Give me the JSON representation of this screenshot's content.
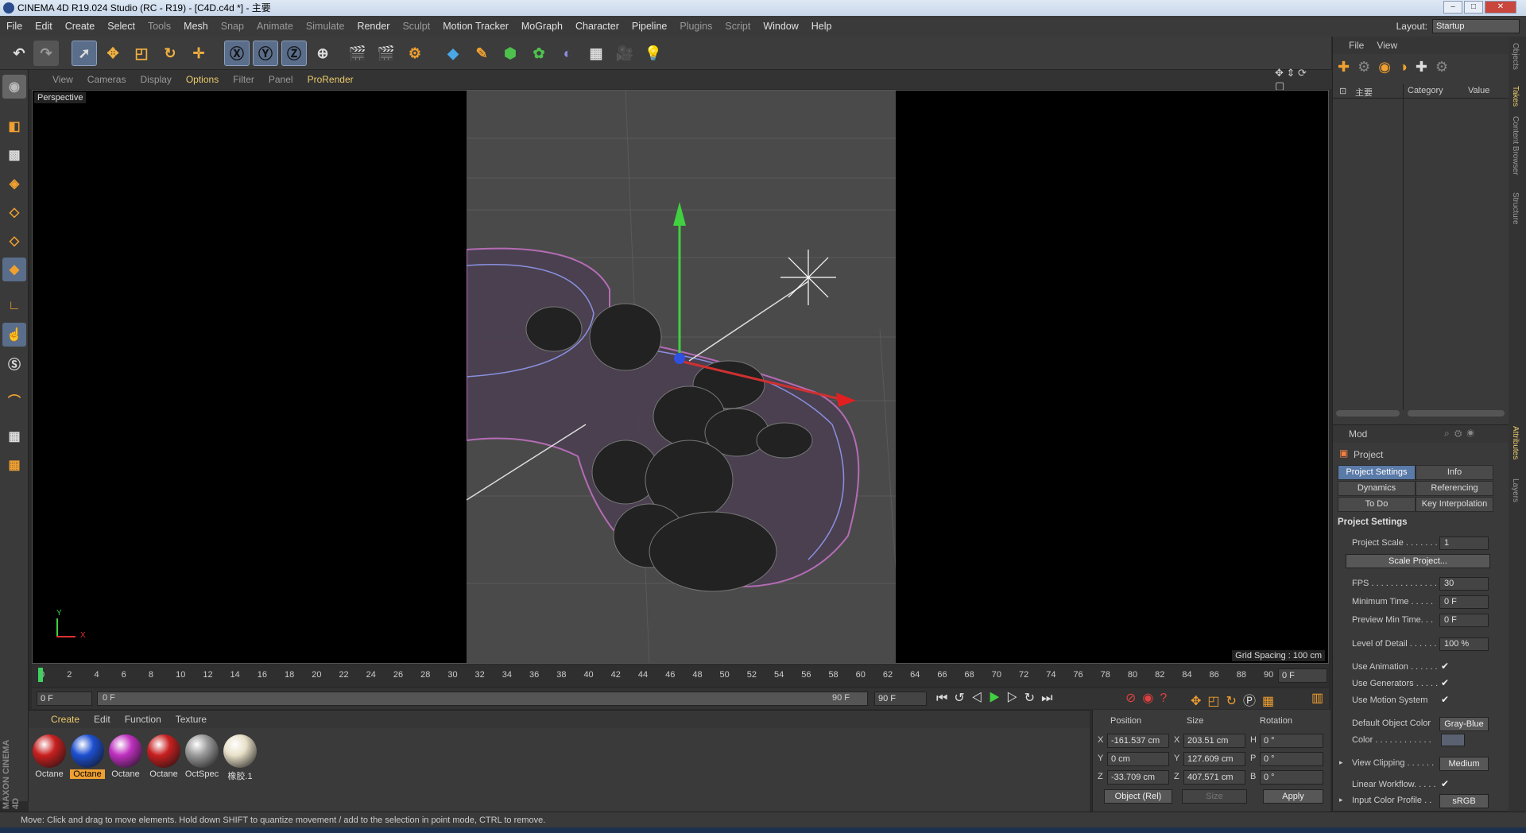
{
  "window": {
    "title": "CINEMA 4D R19.024 Studio (RC - R19) - [C4D.c4d *] - 主要"
  },
  "menu": [
    "File",
    "Edit",
    "Create",
    "Select",
    "Tools",
    "Mesh",
    "Snap",
    "Animate",
    "Simulate",
    "Render",
    "Sculpt",
    "Motion Tracker",
    "MoGraph",
    "Character",
    "Pipeline",
    "Plugins",
    "Script",
    "Window",
    "Help"
  ],
  "layout": {
    "label": "Layout:",
    "value": "Startup"
  },
  "viewport_menu": [
    "View",
    "Cameras",
    "Display",
    "Options",
    "Filter",
    "Panel",
    "ProRender"
  ],
  "viewport": {
    "label": "Perspective",
    "grid_spacing": "Grid Spacing : 100 cm",
    "axis_y": "Y",
    "axis_x": "X"
  },
  "timeline": {
    "ticks": [
      "0",
      "2",
      "4",
      "6",
      "8",
      "10",
      "12",
      "14",
      "16",
      "18",
      "20",
      "22",
      "24",
      "26",
      "28",
      "30",
      "32",
      "34",
      "36",
      "38",
      "40",
      "42",
      "44",
      "46",
      "48",
      "50",
      "52",
      "54",
      "56",
      "58",
      "60",
      "62",
      "64",
      "66",
      "68",
      "70",
      "72",
      "74",
      "76",
      "78",
      "80",
      "82",
      "84",
      "86",
      "88",
      "90"
    ],
    "current_frame": "0 F",
    "start_field": "0 F",
    "range_start": "0 F",
    "range_end": "90 F",
    "end_field": "90 F"
  },
  "material_manager": {
    "menu": [
      "Create",
      "Edit",
      "Function",
      "Texture"
    ],
    "materials": [
      {
        "label": "Octane",
        "color": "#c82020"
      },
      {
        "label": "Octane",
        "color": "#1d4fd0"
      },
      {
        "label": "Octane",
        "color": "#c030c0"
      },
      {
        "label": "Octane",
        "color": "#c82020"
      },
      {
        "label": "OctSpec",
        "color": "#9a9a9a"
      },
      {
        "label": "橡胶.1",
        "color": "#e8e0c8"
      }
    ]
  },
  "coordinates": {
    "headers": {
      "position": "Position",
      "size": "Size",
      "rotation": "Rotation"
    },
    "rows": [
      {
        "axis": "X",
        "pos": "-161.537 cm",
        "saxis": "X",
        "size": "203.51 cm",
        "raxis": "H",
        "rot": "0 °"
      },
      {
        "axis": "Y",
        "pos": "0 cm",
        "saxis": "Y",
        "size": "127.609 cm",
        "raxis": "P",
        "rot": "0 °"
      },
      {
        "axis": "Z",
        "pos": "-33.709 cm",
        "saxis": "Z",
        "size": "407.571 cm",
        "raxis": "B",
        "rot": "0 °"
      }
    ],
    "mode": "Object (Rel)",
    "size_mode": "Size",
    "apply": "Apply"
  },
  "objects_panel": {
    "menu": [
      "File",
      "View"
    ],
    "column_name": "主要",
    "col_category": "Category",
    "col_value": "Value"
  },
  "attributes": {
    "mode_label": "Mod",
    "object": "Project",
    "tabs": [
      "Project Settings",
      "Info",
      "Dynamics",
      "Referencing",
      "To Do",
      "Key Interpolation"
    ],
    "section": "Project Settings",
    "project_scale_label": "Project Scale . . . . . . .",
    "project_scale": "1",
    "scale_button": "Scale Project...",
    "fps_label": "FPS . . . . . . . . . . . . . . .",
    "fps": "30",
    "min_time_label": "Minimum Time . . . . .",
    "min_time": "0 F",
    "preview_min_label": "Preview Min Time. . .",
    "preview_min": "0 F",
    "lod_label": "Level of Detail . . . . . .",
    "lod": "100 %",
    "use_animation": "Use Animation . . . . . .",
    "use_generators": "Use Generators . . . . .",
    "use_motion": "Use Motion System",
    "default_color_label": "Default Object Color",
    "default_color": "Gray-Blue",
    "color_label": "Color . . . . . . . . . . . .",
    "view_clipping_label": "View Clipping . . . . . .",
    "view_clipping": "Medium",
    "linear_workflow": "Linear Workflow. . . . .",
    "input_color_label": "Input Color Profile . .",
    "input_color": "sRGB"
  },
  "side_tabs": [
    "Objects",
    "Takes",
    "Content Browser",
    "Structure",
    "Attributes",
    "Layers"
  ],
  "brand": "MAXON CINEMA 4D",
  "status": "Move: Click and drag to move elements. Hold down SHIFT to quantize movement / add to the selection in point mode, CTRL to remove."
}
